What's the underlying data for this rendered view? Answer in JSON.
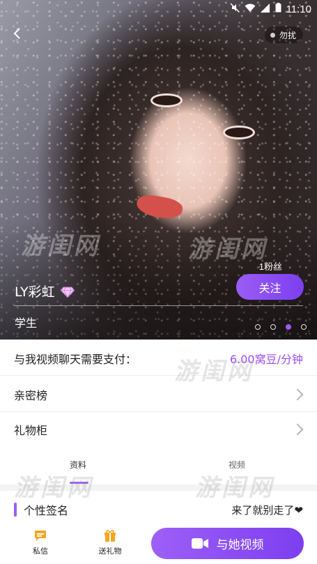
{
  "status_bar": {
    "time": "11:10"
  },
  "header": {
    "dnd_label": "勿扰"
  },
  "profile": {
    "fans": "1粉丝",
    "follow_label": "关注",
    "name": "LY彩虹",
    "profession": "学生",
    "pager_count": 4,
    "pager_active": 3
  },
  "watermark": "游闺网",
  "price_row": {
    "label": "与我视频聊天需要支付：",
    "value": "6.00窝豆/分钟"
  },
  "menu": [
    {
      "label": "亲密榜"
    },
    {
      "label": "礼物柜"
    }
  ],
  "tabs": [
    {
      "label": "资料",
      "active": true
    },
    {
      "label": "视频",
      "active": false
    }
  ],
  "signature": {
    "title": "个性签名",
    "value": "来了就别走了❤"
  },
  "bottom_bar": {
    "message_label": "私信",
    "gift_label": "送礼物",
    "video_label": "与她视频"
  },
  "colors": {
    "accent": "#9b5cf6",
    "price": "#9b4df5"
  },
  "icons": [
    "back-icon",
    "wifi-icon",
    "signal-icon",
    "battery-icon",
    "mute-icon",
    "gem-icon",
    "chevron-right-icon",
    "message-icon",
    "gift-icon",
    "video-camera-icon"
  ]
}
